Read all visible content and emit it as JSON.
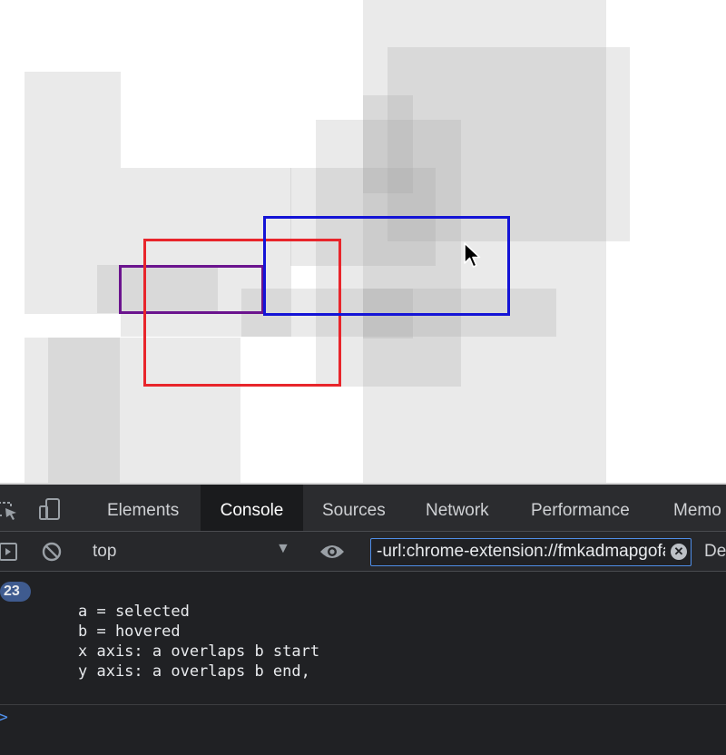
{
  "devtools": {
    "tabs": [
      {
        "label": "Elements"
      },
      {
        "label": "Console",
        "active": true
      },
      {
        "label": "Sources"
      },
      {
        "label": "Network"
      },
      {
        "label": "Performance"
      },
      {
        "label": "Memo"
      }
    ],
    "toolbar": {
      "context": "top",
      "filter_value": "-url:chrome-extension://fmkadmapgofadopljbjfkapdkoienihi",
      "levels_label": "De"
    },
    "console": {
      "message_count": "23",
      "lines": [
        "a = selected",
        "b = hovered",
        "x axis: a overlaps b start",
        "y axis: a overlaps b end,"
      ]
    }
  },
  "colors": {
    "selected_box": "#e8252b",
    "hovered_box": "#1414d6",
    "purple_box": "#6b148e",
    "devtools_bg": "#202124",
    "accent": "#4f8ee8"
  },
  "icons": [
    "inspect-element-icon",
    "device-toolbar-icon",
    "sidebar-toggle-icon",
    "clear-console-icon",
    "eye-icon",
    "clear-filter-icon",
    "prompt-caret-icon",
    "mouse-cursor-icon"
  ]
}
